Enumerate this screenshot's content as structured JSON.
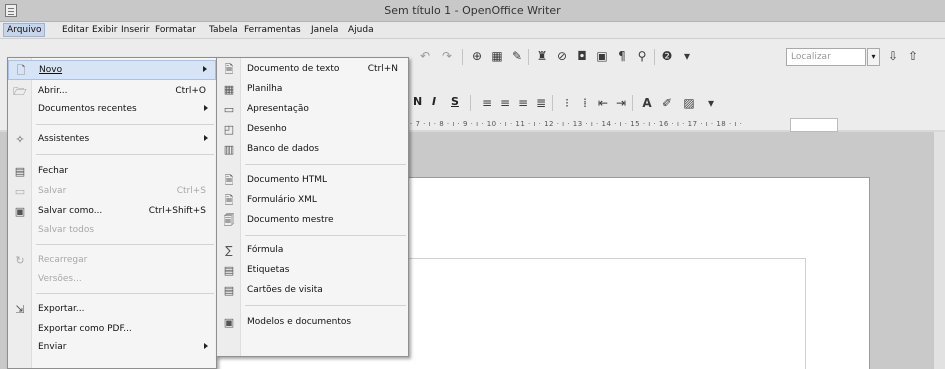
{
  "window": {
    "title": "Sem título 1 - OpenOffice Writer"
  },
  "menubar": {
    "items": [
      "Arquivo",
      "Editar",
      "Exibir",
      "Inserir",
      "Formatar",
      "Tabela",
      "Ferramentas",
      "Janela",
      "Ajuda"
    ]
  },
  "toolbar": {
    "search_placeholder": "Localizar",
    "bold": "N",
    "italic": "I",
    "underline": "S"
  },
  "ruler": {
    "text": "· 7 · ı · 8 · ı · 9 · ı · 10 · ı · 11 · ı · 12 · ı · 13 · ı · 14 · ı · 15 · ı · 16 · ı · 17 · ı · 18 · ı ·"
  },
  "file_menu": {
    "items": [
      {
        "label": "Novo",
        "shortcut": "",
        "submenu": true,
        "enabled": true,
        "icon": "new-doc-icon"
      },
      {
        "label": "Abrir...",
        "shortcut": "Ctrl+O",
        "submenu": false,
        "enabled": true,
        "icon": "open-folder-icon"
      },
      {
        "label": "Documentos recentes",
        "shortcut": "",
        "submenu": true,
        "enabled": true,
        "icon": ""
      },
      {
        "label": "Assistentes",
        "shortcut": "",
        "submenu": true,
        "enabled": true,
        "icon": "wizard-icon"
      },
      {
        "label": "Fechar",
        "shortcut": "",
        "submenu": false,
        "enabled": true,
        "icon": "close-doc-icon"
      },
      {
        "label": "Salvar",
        "shortcut": "Ctrl+S",
        "submenu": false,
        "enabled": false,
        "icon": "save-icon"
      },
      {
        "label": "Salvar como...",
        "shortcut": "Ctrl+Shift+S",
        "submenu": false,
        "enabled": true,
        "icon": "save-as-icon"
      },
      {
        "label": "Salvar todos",
        "shortcut": "",
        "submenu": false,
        "enabled": false,
        "icon": ""
      },
      {
        "label": "Recarregar",
        "shortcut": "",
        "submenu": false,
        "enabled": false,
        "icon": "reload-icon"
      },
      {
        "label": "Versões...",
        "shortcut": "",
        "submenu": false,
        "enabled": false,
        "icon": ""
      },
      {
        "label": "Exportar...",
        "shortcut": "",
        "submenu": false,
        "enabled": true,
        "icon": "export-icon"
      },
      {
        "label": "Exportar como PDF...",
        "shortcut": "",
        "submenu": false,
        "enabled": true,
        "icon": ""
      },
      {
        "label": "Enviar",
        "shortcut": "",
        "submenu": true,
        "enabled": true,
        "icon": ""
      }
    ]
  },
  "new_submenu": {
    "items": [
      {
        "label": "Documento de texto",
        "shortcut": "Ctrl+N",
        "icon": "text-document-icon"
      },
      {
        "label": "Planilha",
        "shortcut": "",
        "icon": "spreadsheet-icon"
      },
      {
        "label": "Apresentação",
        "shortcut": "",
        "icon": "presentation-icon"
      },
      {
        "label": "Desenho",
        "shortcut": "",
        "icon": "drawing-icon"
      },
      {
        "label": "Banco de dados",
        "shortcut": "",
        "icon": "database-icon"
      },
      {
        "label": "Documento HTML",
        "shortcut": "",
        "icon": "html-document-icon"
      },
      {
        "label": "Formulário XML",
        "shortcut": "",
        "icon": "xml-form-icon"
      },
      {
        "label": "Documento mestre",
        "shortcut": "",
        "icon": "master-document-icon"
      },
      {
        "label": "Fórmula",
        "shortcut": "",
        "icon": "formula-icon"
      },
      {
        "label": "Etiquetas",
        "shortcut": "",
        "icon": "labels-icon"
      },
      {
        "label": "Cartões de visita",
        "shortcut": "",
        "icon": "business-cards-icon"
      },
      {
        "label": "Modelos e documentos",
        "shortcut": "",
        "icon": "templates-icon"
      }
    ]
  },
  "colors": {
    "menu_highlight": "#d7e4f5",
    "disabled_text": "#a8a8a8"
  }
}
